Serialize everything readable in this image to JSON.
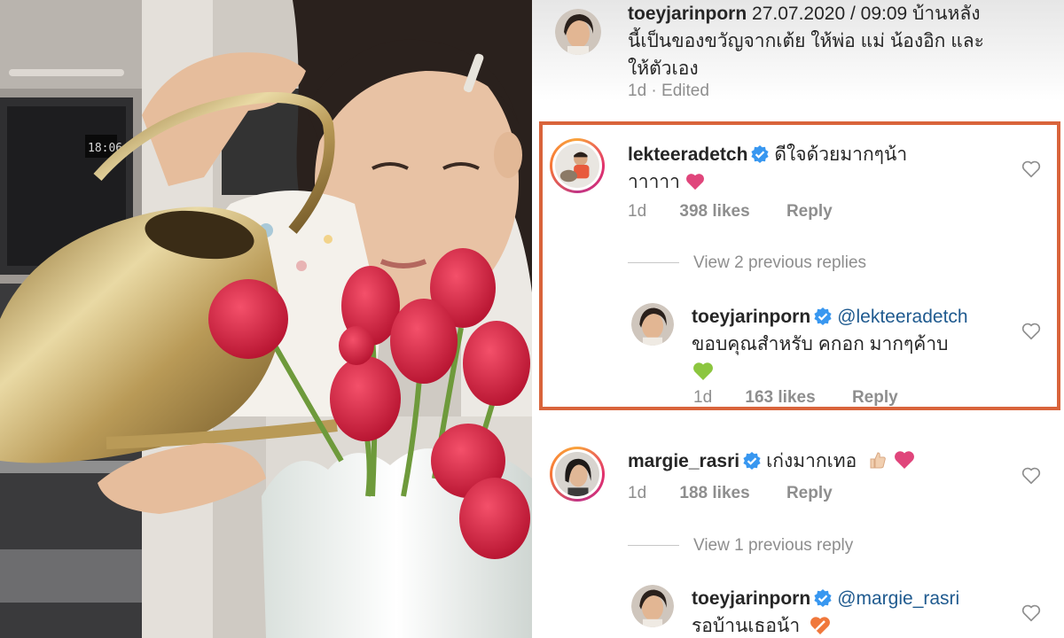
{
  "comments": [
    {
      "username": "toeyjarinporn",
      "text_line1": "27.07.2020 / 09:09 บ้านหลัง",
      "text_line2": "นี้เป็นของขวัญจากเต้ย ให้พ่อ แม่ น้องอิก และ",
      "text_line3": "ให้ตัวเอง",
      "time": "1d · Edited"
    },
    {
      "username": "lekteeradetch",
      "text_line1": "ดีใจด้วยมากๆน้า",
      "text_line2": "าาาาา",
      "time": "1d",
      "likes": "398 likes",
      "reply": "Reply",
      "view_replies": "View 2 previous replies",
      "reply_comment": {
        "username": "toeyjarinporn",
        "mention": "@lekteeradetch",
        "text_line1": "ขอบคุณสำหรับ คกอก มากๆค้าบ",
        "time": "1d",
        "likes": "163 likes",
        "reply": "Reply"
      }
    },
    {
      "username": "margie_rasri",
      "text": "เก่งมากเทอ",
      "time": "1d",
      "likes": "188 likes",
      "reply": "Reply",
      "view_replies": "View 1 previous reply",
      "reply_comment": {
        "username": "toeyjarinporn",
        "mention": "@margie_rasri",
        "text_line1": "รอบ้านเธอน้า"
      }
    }
  ],
  "oven_clock": "18:06",
  "colors": {
    "highlight_border": "#d9643b",
    "verified_blue": "#3897f0",
    "pink_heart": "#e0457b",
    "green_heart": "#8cc63f",
    "orange_heart": "#f0783c"
  }
}
